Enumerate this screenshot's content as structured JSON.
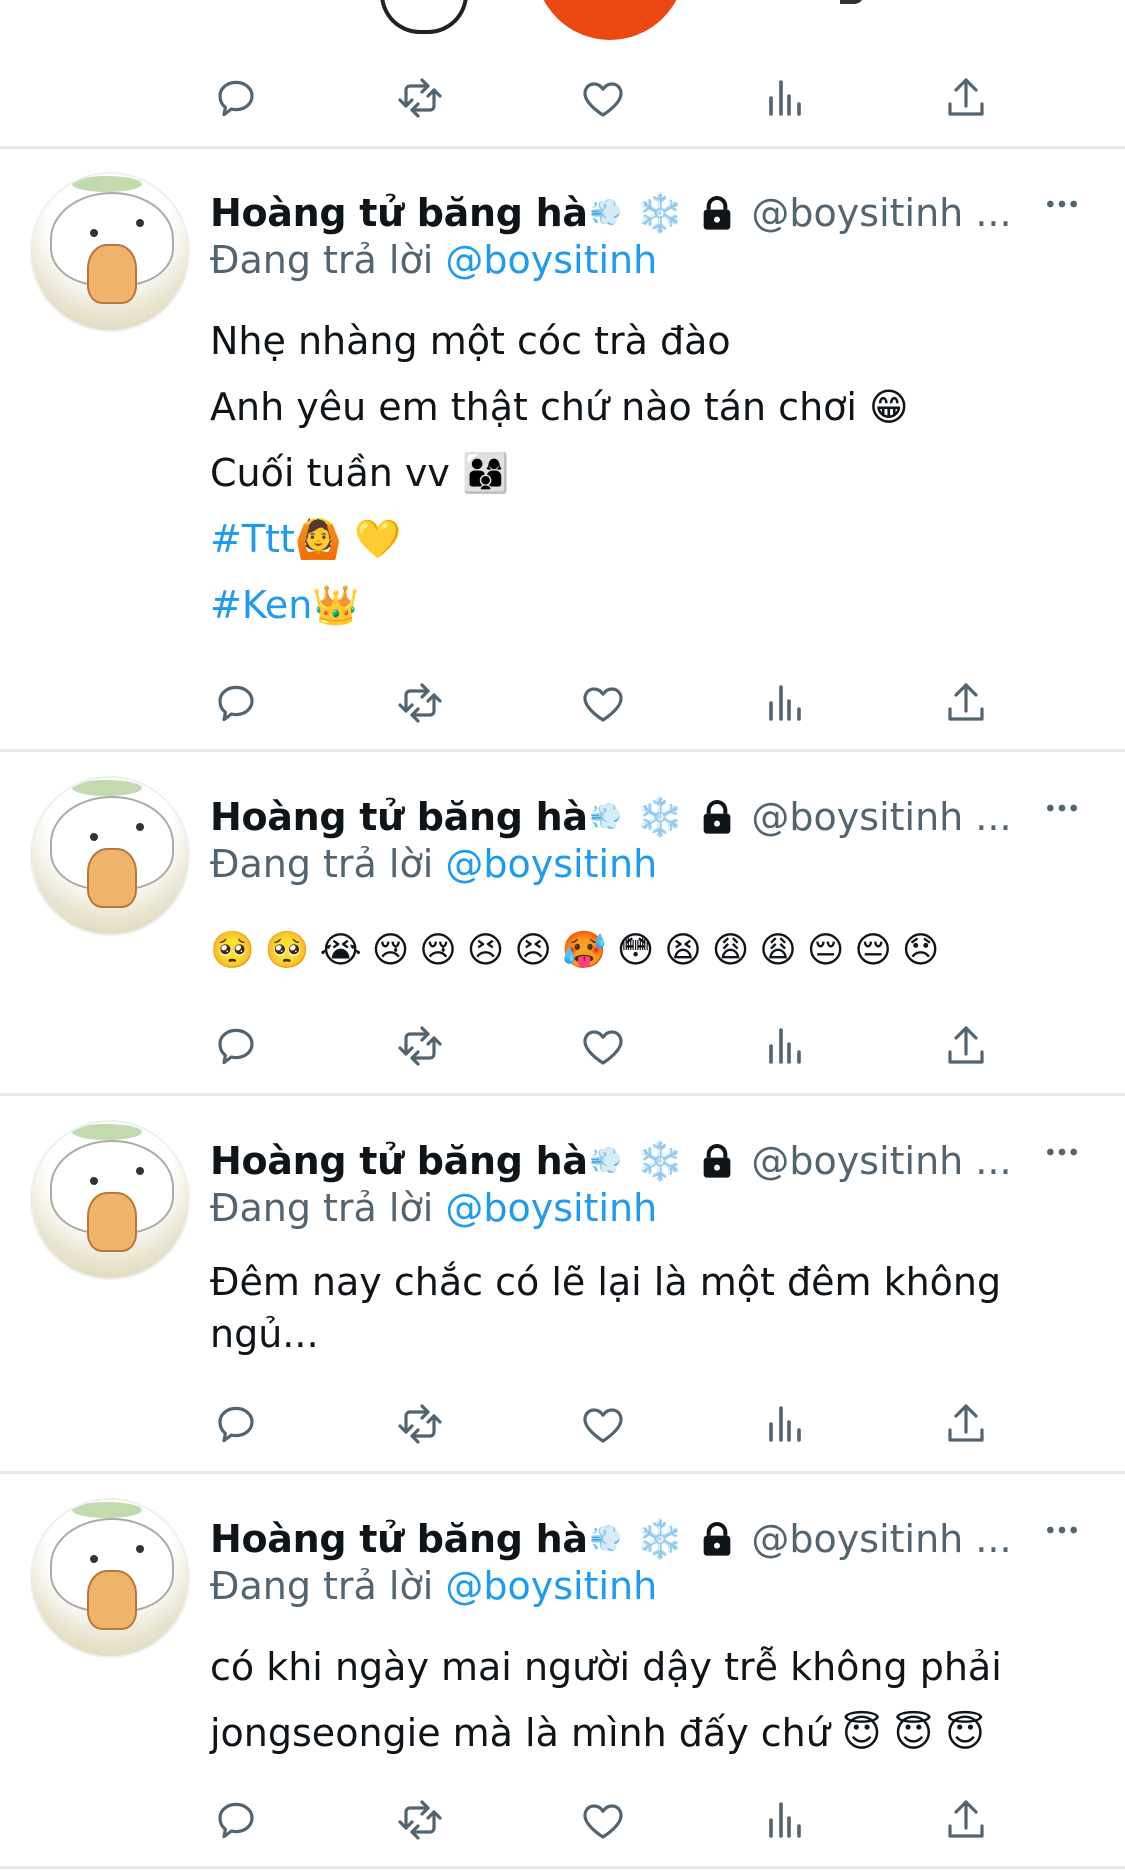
{
  "colors": {
    "text": "#0f1419",
    "secondary": "#536471",
    "link": "#1d9bf0",
    "divider": "#e6e9ec",
    "icon": "#536471"
  },
  "icons": {
    "reply": "reply-icon",
    "retweet": "retweet-icon",
    "like": "heart-icon",
    "stats": "analytics-icon",
    "share": "share-icon",
    "more": "more-icon",
    "lock": "lock-icon",
    "snowflake": "snowflake-emoji",
    "name_emoji": "dash-emoji"
  },
  "author": {
    "name": "Hoàng tử băng hà",
    "name_emoji": "💨",
    "snowflake": "❄️",
    "handle": "@boysitinh ..."
  },
  "replying": {
    "prefix": "Đang trả lời",
    "mention": "@boysitinh"
  },
  "tweets": [
    {
      "lines": [
        "Nhẹ nhàng một cóc trà đào",
        "Anh yêu em thật chứ nào tán chơi 😁",
        "Cuối tuần vv 👨‍👩‍👦"
      ],
      "tags": [
        "#Ttt🙆 💛",
        "#Ken👑"
      ]
    },
    {
      "emojis": [
        "🥺",
        "🥺",
        "😭",
        "😢",
        "😢",
        "😣",
        "😣",
        "🥵",
        "😳",
        "😫",
        "😩",
        "😩",
        "😔",
        "😔",
        "😞"
      ]
    },
    {
      "lines": [
        "Đêm nay chắc có lẽ lại là một đêm không",
        "ngủ..."
      ]
    },
    {
      "lines": [
        "có khi ngày mai người dậy trễ không phải",
        "jongseongie mà là mình đấy chứ 😇 😇 😇"
      ]
    }
  ]
}
